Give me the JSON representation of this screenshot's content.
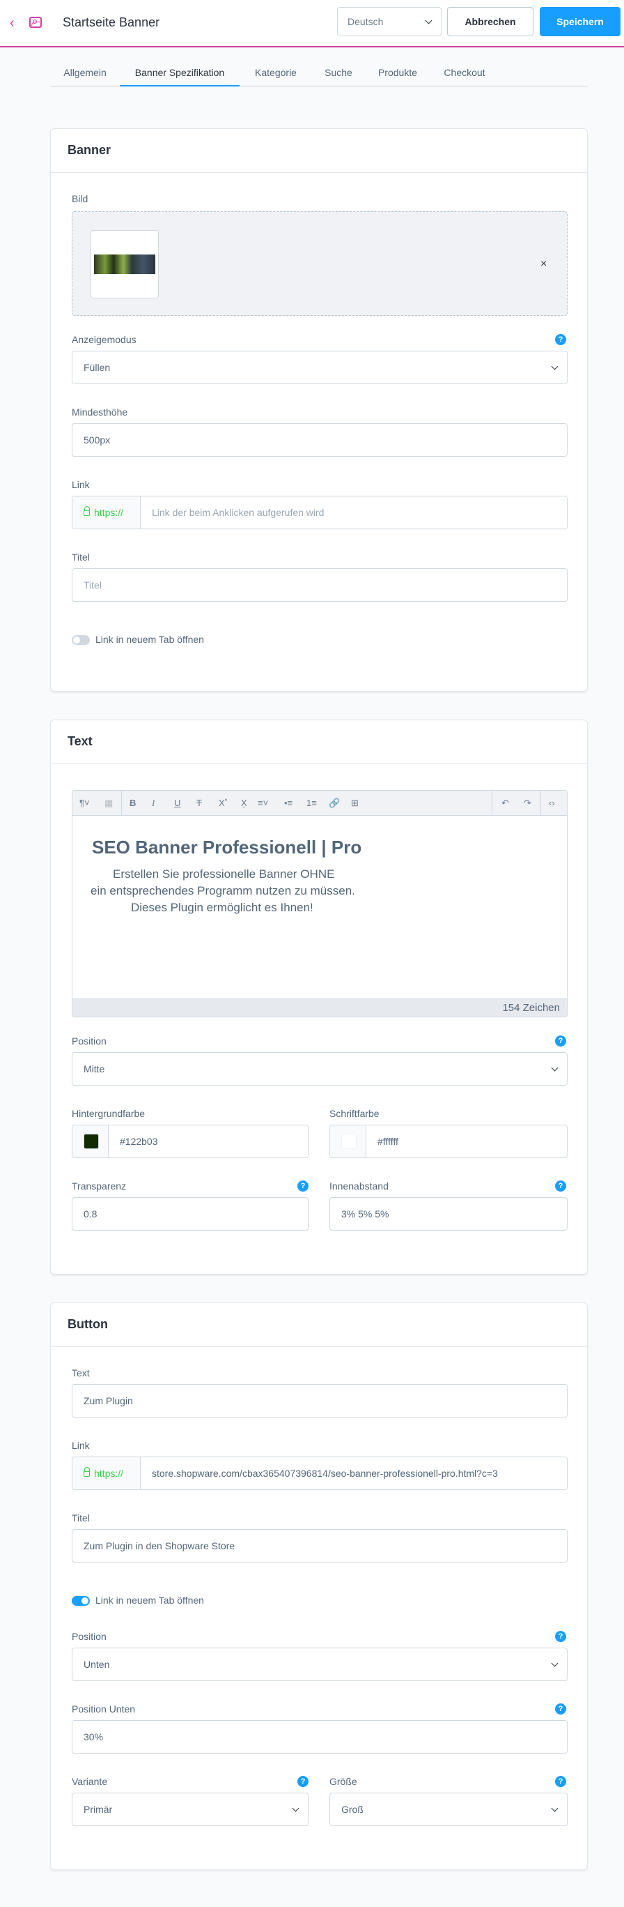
{
  "header": {
    "title": "Startseite Banner",
    "language": "Deutsch",
    "cancel_label": "Abbrechen",
    "save_label": "Speichern"
  },
  "tabs": [
    "Allgemein",
    "Banner Spezifikation",
    "Kategorie",
    "Suche",
    "Produkte",
    "Checkout"
  ],
  "active_tab": "Banner Spezifikation",
  "banner": {
    "title": "Banner",
    "image_label": "Bild",
    "remove_glyph": "×",
    "display_mode_label": "Anzeigemodus",
    "display_mode_value": "Füllen",
    "min_height_label": "Mindesthöhe",
    "min_height_value": "500px",
    "link_label": "Link",
    "link_prefix": "https://",
    "link_placeholder": "Link der beim Anklicken aufgerufen wird",
    "title_label": "Titel",
    "title_placeholder": "Titel",
    "new_tab_label": "Link in neuem Tab öffnen",
    "new_tab_on": false
  },
  "text": {
    "title": "Text",
    "editor_heading": "SEO Banner Professionell | Pro",
    "editor_lines": [
      "Erstellen Sie professionelle Banner OHNE",
      "ein entsprechendes Programm nutzen zu müssen.",
      "Dieses Plugin ermöglicht es Ihnen!"
    ],
    "char_count": "154 Zeichen",
    "position_label": "Position",
    "position_value": "Mitte",
    "bg_color_label": "Hintergrundfarbe",
    "bg_color_value": "#122b03",
    "font_color_label": "Schriftfarbe",
    "font_color_value": "#ffffff",
    "transparency_label": "Transparenz",
    "transparency_value": "0.8",
    "padding_label": "Innenabstand",
    "padding_value": "3% 5% 5%"
  },
  "button": {
    "title": "Button",
    "text_label": "Text",
    "text_value": "Zum Plugin",
    "link_label": "Link",
    "link_prefix": "https://",
    "link_value": "store.shopware.com/cbax365407396814/seo-banner-professionell-pro.html?c=3",
    "title_label": "Titel",
    "title_value": "Zum Plugin in den Shopware Store",
    "new_tab_label": "Link in neuem Tab öffnen",
    "new_tab_on": true,
    "position_label": "Position",
    "position_value": "Unten",
    "position_bottom_label": "Position Unten",
    "position_bottom_value": "30%",
    "variant_label": "Variante",
    "variant_value": "Primär",
    "size_label": "Größe",
    "size_value": "Groß"
  },
  "help_glyph": "?",
  "colors": {
    "accent": "#189eff",
    "brand": "#d63ea1",
    "https": "#37d046"
  }
}
